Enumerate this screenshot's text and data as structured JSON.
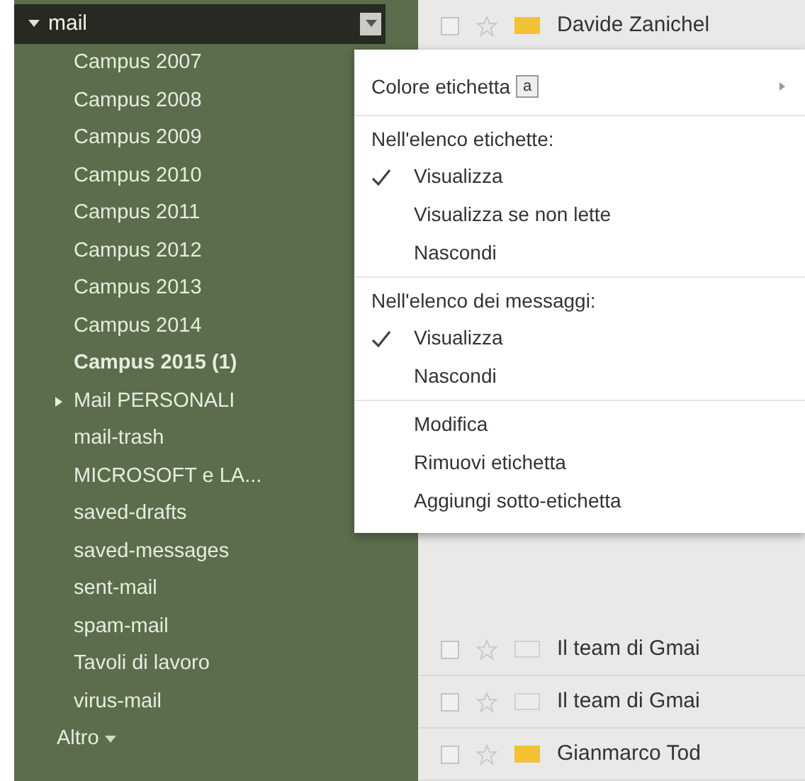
{
  "sidebar": {
    "header": {
      "label": "mail",
      "expanded": true
    },
    "items": [
      {
        "label": "Campus 2007",
        "unread": false,
        "expandable": false
      },
      {
        "label": "Campus 2008",
        "unread": false,
        "expandable": false
      },
      {
        "label": "Campus 2009",
        "unread": false,
        "expandable": false
      },
      {
        "label": "Campus 2010",
        "unread": false,
        "expandable": false
      },
      {
        "label": "Campus 2011",
        "unread": false,
        "expandable": false
      },
      {
        "label": "Campus 2012",
        "unread": false,
        "expandable": false
      },
      {
        "label": "Campus 2013",
        "unread": false,
        "expandable": false
      },
      {
        "label": "Campus 2014",
        "unread": false,
        "expandable": false
      },
      {
        "label": "Campus 2015 (1)",
        "unread": true,
        "expandable": false
      },
      {
        "label": "Mail PERSONALI",
        "unread": false,
        "expandable": true
      },
      {
        "label": "mail-trash",
        "unread": false,
        "expandable": false
      },
      {
        "label": "MICROSOFT e LA...",
        "unread": false,
        "expandable": false
      },
      {
        "label": "saved-drafts",
        "unread": false,
        "expandable": false
      },
      {
        "label": "saved-messages",
        "unread": false,
        "expandable": false
      },
      {
        "label": "sent-mail",
        "unread": false,
        "expandable": false
      },
      {
        "label": "spam-mail",
        "unread": false,
        "expandable": false
      },
      {
        "label": "Tavoli di lavoro",
        "unread": false,
        "expandable": false
      },
      {
        "label": "virus-mail",
        "unread": false,
        "expandable": false
      }
    ],
    "more": "Altro"
  },
  "menu": {
    "sections": [
      {
        "items": [
          {
            "kind": "color",
            "label": "Colore etichetta",
            "swatch": "a"
          }
        ]
      },
      {
        "heading": "Nell'elenco etichette:",
        "items": [
          {
            "kind": "option",
            "label": "Visualizza",
            "checked": true
          },
          {
            "kind": "option",
            "label": "Visualizza se non lette",
            "checked": false
          },
          {
            "kind": "option",
            "label": "Nascondi",
            "checked": false
          }
        ]
      },
      {
        "heading": "Nell'elenco dei messaggi:",
        "items": [
          {
            "kind": "option",
            "label": "Visualizza",
            "checked": true
          },
          {
            "kind": "option",
            "label": "Nascondi",
            "checked": false
          }
        ]
      },
      {
        "items": [
          {
            "kind": "action",
            "label": "Modifica"
          },
          {
            "kind": "action",
            "label": "Rimuovi etichetta"
          },
          {
            "kind": "action",
            "label": "Aggiungi sotto-etichetta"
          }
        ]
      }
    ]
  },
  "messages": [
    {
      "sender": "Davide Zanichel",
      "important": true,
      "checked": false
    },
    {
      "sender": "Il team di Gmai",
      "important": false,
      "checked": false
    },
    {
      "sender": "Il team di Gmai",
      "important": false,
      "checked": false
    },
    {
      "sender": "Gianmarco Tod",
      "important": true,
      "checked": false
    }
  ]
}
